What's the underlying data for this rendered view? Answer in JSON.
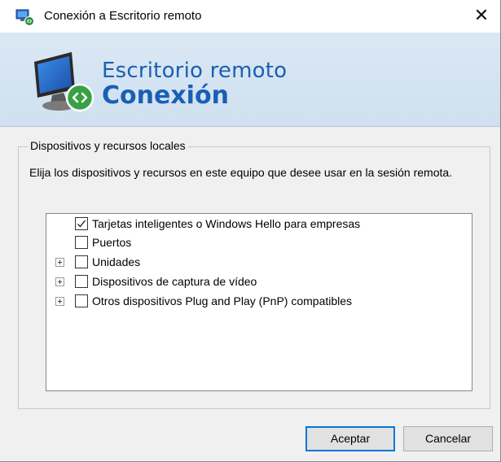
{
  "window": {
    "title": "Conexión a Escritorio remoto",
    "close_glyph": "✕"
  },
  "banner": {
    "line1": "Escritorio remoto",
    "line2": "Conexión",
    "icon": "remote-desktop-monitor-icon"
  },
  "group": {
    "legend": "Dispositivos y recursos locales",
    "description": "Elija los dispositivos y recursos en este equipo que desee usar en la sesión remota."
  },
  "devices": [
    {
      "label": "Tarjetas inteligentes o Windows Hello para empresas",
      "checked": true,
      "expandable": false
    },
    {
      "label": "Puertos",
      "checked": false,
      "expandable": false
    },
    {
      "label": "Unidades",
      "checked": false,
      "expandable": true
    },
    {
      "label": "Dispositivos de captura de vídeo",
      "checked": false,
      "expandable": true
    },
    {
      "label": "Otros dispositivos Plug and Play (PnP) compatibles",
      "checked": false,
      "expandable": true
    }
  ],
  "buttons": {
    "ok": "Aceptar",
    "cancel": "Cancelar"
  },
  "colors": {
    "accent": "#0078d7",
    "banner_text": "#1a5fb4",
    "banner_bg": "#d6e5f3"
  }
}
